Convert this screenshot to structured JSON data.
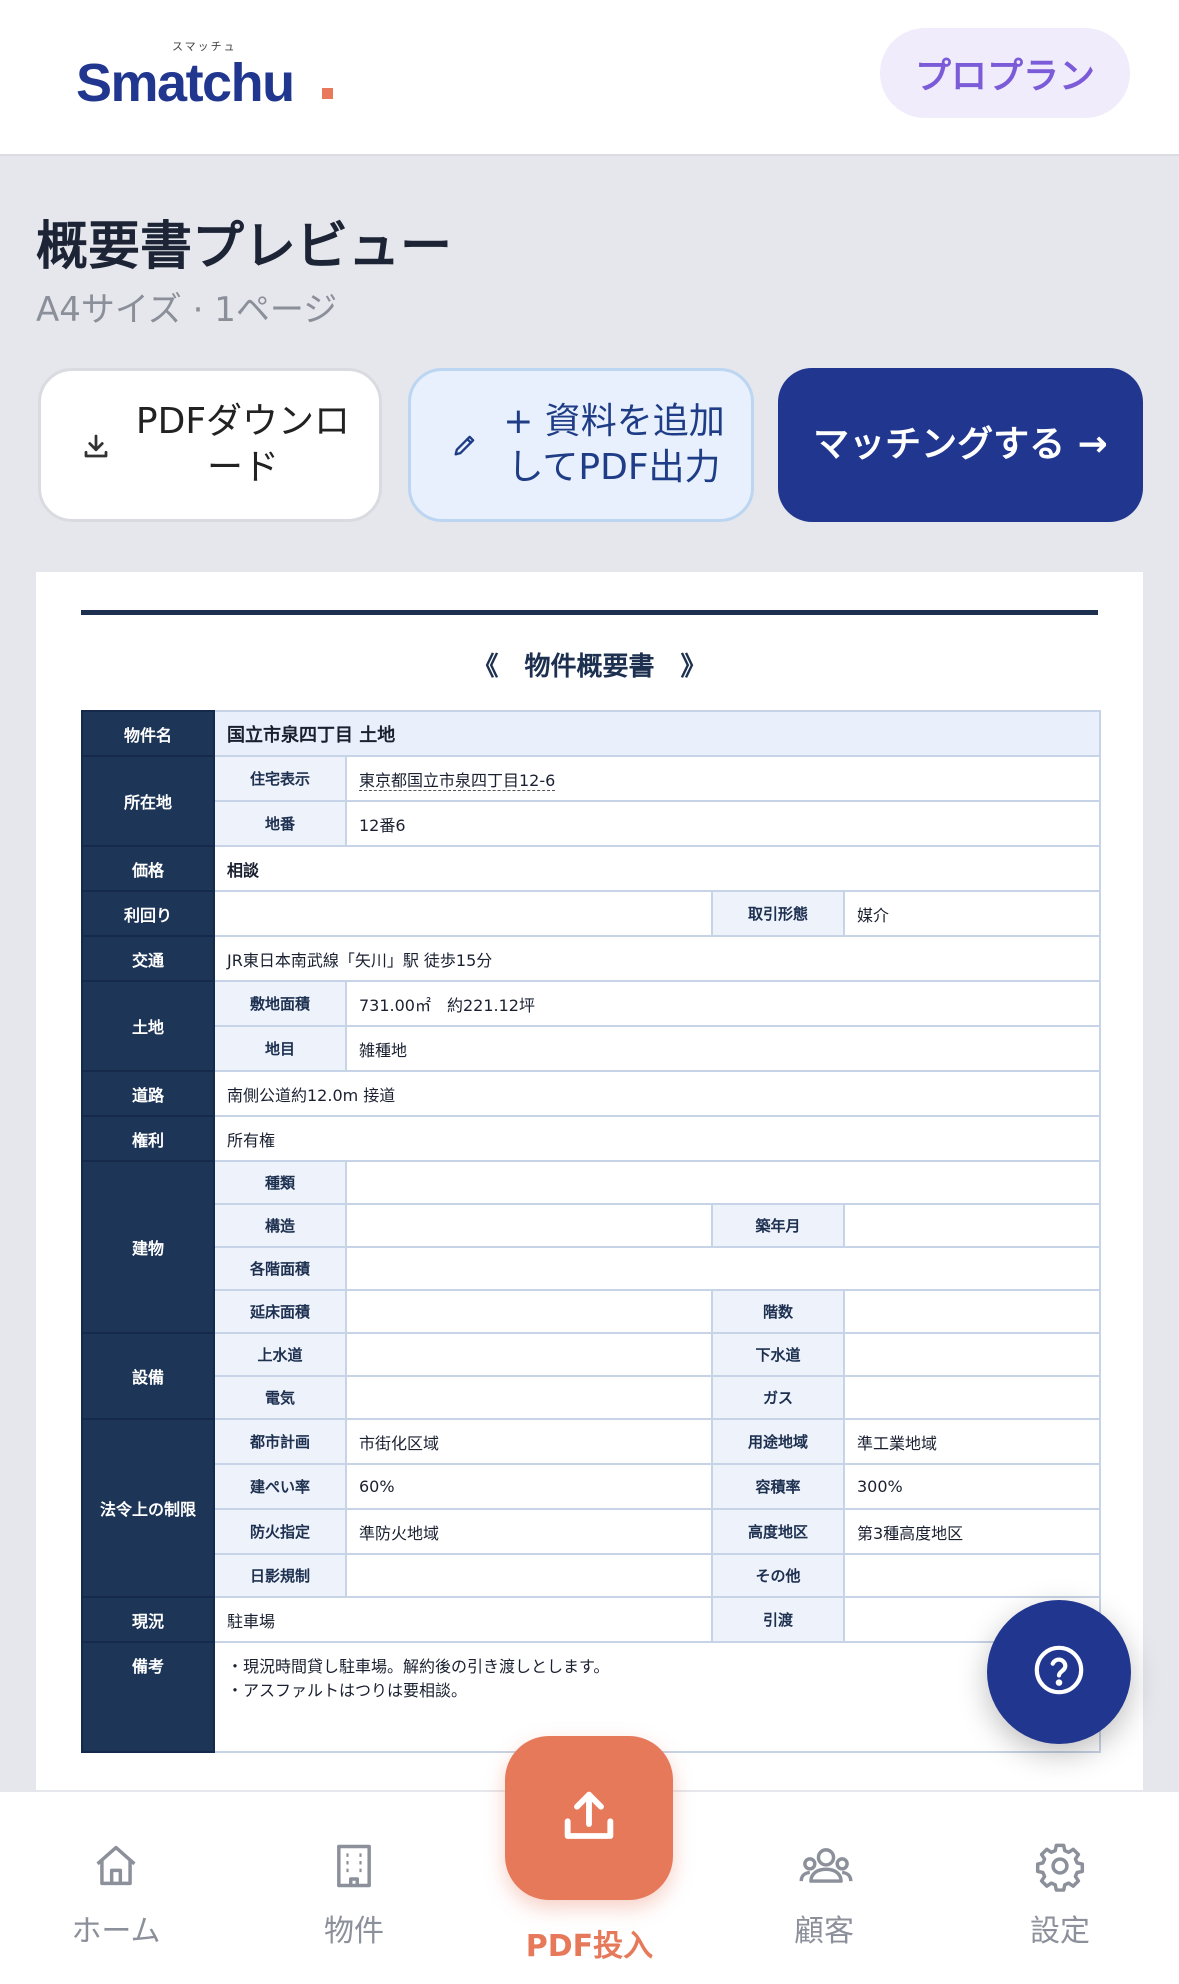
{
  "header": {
    "logo_ruby": "スマッチュ",
    "logo_text": "Smatchu",
    "plan_label": "プロプラン"
  },
  "page": {
    "title": "概要書プレビュー",
    "subtitle": "A4サイズ · 1ページ"
  },
  "actions": {
    "download_label": "PDFダウンロード",
    "add_label": "+ 資料を追加してPDF出力",
    "match_label": "マッチングする →"
  },
  "doc": {
    "heading": "《　物件概要書　》",
    "rows": {
      "name_label": "物件名",
      "name_value": "国立市泉四丁目 土地",
      "location_label": "所在地",
      "address_label": "住宅表示",
      "address_value": "東京都国立市泉四丁目12-6",
      "lot_label": "地番",
      "lot_value": "12番6",
      "price_label": "価格",
      "price_value": "相談",
      "yield_label": "利回り",
      "yield_value": "",
      "deal_label": "取引形態",
      "deal_value": "媒介",
      "transport_label": "交通",
      "transport_value": "JR東日本南武線「矢川」駅 徒歩15分",
      "land_label": "土地",
      "site_area_label": "敷地面積",
      "site_area_value": "731.00㎡　約221.12坪",
      "land_category_label": "地目",
      "land_category_value": "雑種地",
      "road_label": "道路",
      "road_value": "南側公道約12.0m 接道",
      "rights_label": "権利",
      "rights_value": "所有権",
      "building_label": "建物",
      "type_label": "種類",
      "type_value": "",
      "structure_label": "構造",
      "structure_value": "",
      "built_label": "築年月",
      "built_value": "",
      "floor_area_label": "各階面積",
      "floor_area_value": "",
      "total_area_label": "延床面積",
      "total_area_value": "",
      "floors_label": "階数",
      "floors_value": "",
      "facilities_label": "設備",
      "water_label": "上水道",
      "water_value": "",
      "sewer_label": "下水道",
      "sewer_value": "",
      "electric_label": "電気",
      "electric_value": "",
      "gas_label": "ガス",
      "gas_value": "",
      "legal_label": "法令上の制限",
      "city_plan_label": "都市計画",
      "city_plan_value": "市街化区域",
      "zoning_label": "用途地域",
      "zoning_value": "準工業地域",
      "coverage_label": "建ぺい率",
      "coverage_value": "60%",
      "far_label": "容積率",
      "far_value": "300%",
      "fire_label": "防火指定",
      "fire_value": "準防火地域",
      "height_label": "高度地区",
      "height_value": "第3種高度地区",
      "shadow_label": "日影規制",
      "shadow_value": "",
      "other_label": "その他",
      "other_value": "",
      "status_label": "現況",
      "status_value": "駐車場",
      "handover_label": "引渡",
      "handover_value": "",
      "remarks_label": "備考",
      "remarks_line1": "・現況時間貸し駐車場。解約後の引き渡しとします。",
      "remarks_line2": "・アスファルトはつりは要相談。"
    }
  },
  "nav": {
    "home": "ホーム",
    "property": "物件",
    "upload": "PDF投入",
    "customer": "顧客",
    "settings": "設定"
  },
  "colors": {
    "brand": "#21378f",
    "accent": "#e7795b",
    "table_header": "#1d3557",
    "plan": "#7b5bd8"
  },
  "icons": [
    "download-icon",
    "pencil-icon",
    "help-icon",
    "home-icon",
    "building-icon",
    "upload-icon",
    "people-icon",
    "gear-icon"
  ]
}
